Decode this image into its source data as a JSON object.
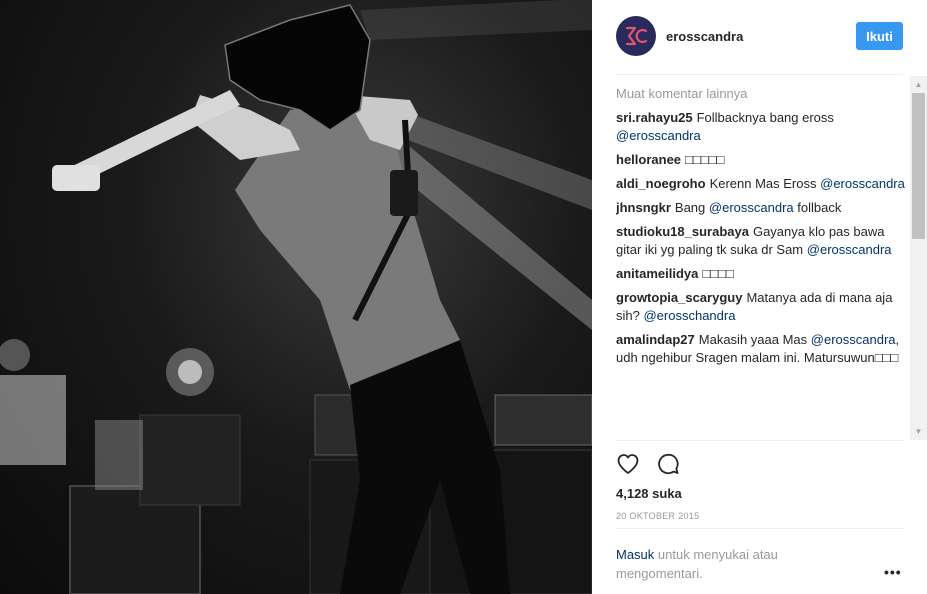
{
  "post": {
    "username": "erosscandra",
    "follow_label": "Ikuti",
    "load_more_comments": "Muat komentar lainnya",
    "likes": "4,128 suka",
    "date": "20 OKTOBER 2015",
    "login_link": "Masuk",
    "login_text": "untuk menyukai atau mengomentari.",
    "more_options": "•••"
  },
  "comments": [
    {
      "user": "sri.rahayu25",
      "text": "Follbacknya bang eross",
      "mention": "@erosscandra",
      "after": ""
    },
    {
      "user": "helloranee",
      "text": "□□□□□",
      "mention": "",
      "after": ""
    },
    {
      "user": "aldi_noegroho",
      "text": "Kerenn Mas Eross",
      "mention": "@erosscandra",
      "after": ""
    },
    {
      "user": "jhnsngkr",
      "text": "Bang",
      "mention": "@erosscandra",
      "after": "follback"
    },
    {
      "user": "studioku18_surabaya",
      "text": "Gayanya klo pas bawa gitar iki yg paling tk suka dr Sam",
      "mention": "@erosscandra",
      "after": ""
    },
    {
      "user": "anitameilidya",
      "text": "□□□□",
      "mention": "",
      "after": ""
    },
    {
      "user": "growtopia_scaryguy",
      "text": "Matanya ada di mana aja sih?",
      "mention": "@erosschandra",
      "after": ""
    },
    {
      "user": "amalindap27",
      "text": "Makasih yaaa Mas",
      "mention": "@erosscandra",
      "after": ", udh ngehibur Sragen malam ini. Matursuwun□□□"
    }
  ],
  "icons": {
    "like": "heart-outline-icon",
    "comment": "speech-bubble-icon",
    "scroll_up": "triangle-up-icon",
    "scroll_down": "triangle-down-icon"
  },
  "colors": {
    "accent": "#3897f0",
    "mention": "#003569",
    "muted": "#999999"
  }
}
